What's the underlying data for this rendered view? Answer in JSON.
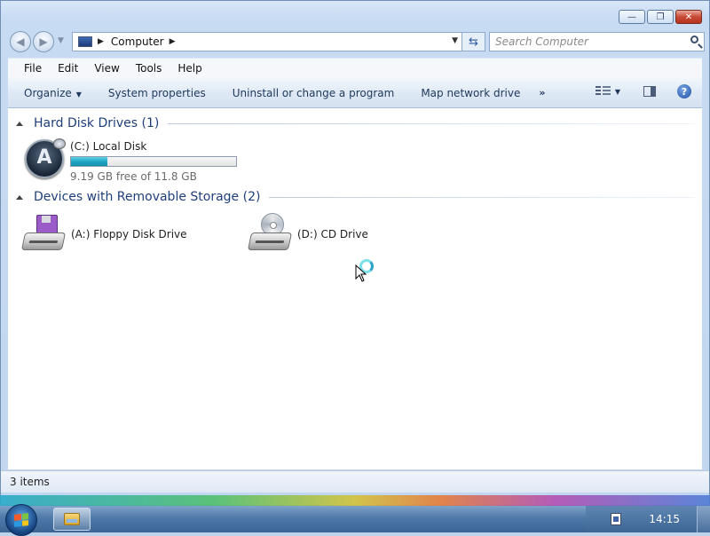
{
  "window": {
    "minimize_label": "—",
    "maximize_label": "❐",
    "close_label": "✕"
  },
  "nav": {
    "back_glyph": "◀",
    "forward_glyph": "▶",
    "address_path": "Computer",
    "search_placeholder": "Search Computer"
  },
  "menu": [
    "File",
    "Edit",
    "View",
    "Tools",
    "Help"
  ],
  "commands": {
    "organize": "Organize",
    "system_properties": "System properties",
    "uninstall": "Uninstall or change a program",
    "map_drive": "Map network drive",
    "more": "»"
  },
  "groups": {
    "hard_disks": {
      "title": "Hard Disk Drives (1)"
    },
    "removable": {
      "title": "Devices with Removable Storage (2)"
    }
  },
  "drives": {
    "c": {
      "label": "(C:) Local Disk",
      "free_text": "9.19 GB free of 11.8 GB",
      "used_fraction": 0.22
    },
    "a": {
      "label": "(A:) Floppy Disk Drive"
    },
    "d": {
      "label": "(D:) CD Drive"
    }
  },
  "status": {
    "items_text": "3 items"
  },
  "taskbar": {
    "clock": "14:15"
  },
  "icons": {
    "computer": "computer-icon",
    "search": "search-icon",
    "help": "help-icon",
    "os_disk": "os-disk-icon",
    "floppy": "floppy-drive-icon",
    "cd": "cd-drive-icon",
    "start": "start-orb-icon",
    "explorer": "explorer-icon"
  }
}
